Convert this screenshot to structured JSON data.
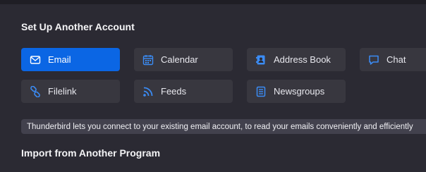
{
  "setup": {
    "title": "Set Up Another Account",
    "buttons": {
      "email": "Email",
      "calendar": "Calendar",
      "address_book": "Address Book",
      "chat": "Chat",
      "filelink": "Filelink",
      "feeds": "Feeds",
      "newsgroups": "Newsgroups"
    },
    "icons": {
      "email": "envelope-icon",
      "calendar": "calendar-icon",
      "address_book": "address-book-icon",
      "chat": "chat-bubble-icon",
      "filelink": "link-icon",
      "feeds": "rss-icon",
      "newsgroups": "newsgroups-icon"
    }
  },
  "tooltip": {
    "text": "Thunderbird lets you connect to your existing email account, to read your emails conveniently and efficiently"
  },
  "import": {
    "title": "Import from Another Program"
  },
  "colors": {
    "background": "#2b2a33",
    "button": "#38373f",
    "primary": "#0b66e4",
    "icon_blue": "#3b8cf5"
  }
}
